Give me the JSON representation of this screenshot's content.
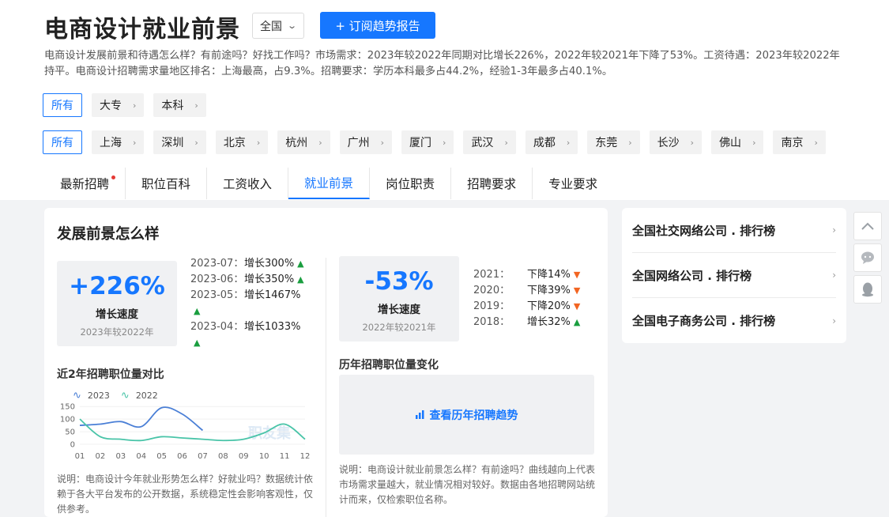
{
  "header": {
    "title": "电商设计就业前景",
    "region": "全国",
    "subscribe_label": "+ 订阅趋势报告",
    "description": "电商设计发展前景和待遇怎么样？有前途吗？好找工作吗？市场需求：2023年较2022年同期对比增长226%，2022年较2021年下降了53%。工资待遇：2023年较2022年持平。电商设计招聘需求量地区排名：上海最高，占9.3%。招聘要求：学历本科最多占44.2%，经验1-3年最多占40.1%。"
  },
  "filters": {
    "education": [
      "所有",
      "大专",
      "本科"
    ],
    "cities": [
      "所有",
      "上海",
      "深圳",
      "北京",
      "杭州",
      "广州",
      "厦门",
      "武汉",
      "成都",
      "东莞",
      "长沙",
      "佛山",
      "南京"
    ]
  },
  "tabs": [
    "最新招聘",
    "职位百科",
    "工资收入",
    "就业前景",
    "岗位职责",
    "招聘要求",
    "专业要求"
  ],
  "active_tab": 3,
  "main": {
    "title": "发展前景怎么样",
    "stat_left": {
      "value": "+226%",
      "label": "增长速度",
      "sub": "2023年较2022年"
    },
    "hist_left": [
      {
        "year": "2023-07：",
        "text": "增长300%"
      },
      {
        "year": "2023-06：",
        "text": "增长350%"
      },
      {
        "year": "2023-05：",
        "text": "增长1467%"
      },
      {
        "year": "2023-04：",
        "text": "增长1033%"
      }
    ],
    "stat_right": {
      "value": "-53%",
      "label": "增长速度",
      "sub": "2022年较2021年"
    },
    "hist_right": [
      {
        "year": "2021：",
        "text": "下降14%"
      },
      {
        "year": "2020：",
        "text": "下降39%"
      },
      {
        "year": "2019：",
        "text": "下降20%"
      },
      {
        "year": "2018：",
        "text": "增长32%"
      }
    ],
    "compare_title": "近2年招聘职位量对比",
    "trend_title": "历年招聘职位量变化",
    "trend_link": "查看历年招聘趋势",
    "watermark": "职友集",
    "note_left": "说明：电商设计今年就业形势怎么样？好就业吗？数据统计依赖于各大平台发布的公开数据，系统稳定性会影响客观性，仅供参考。",
    "note_right": "说明：电商设计就业前景怎么样？有前途吗？曲线越向上代表市场需求量越大，就业情况相对较好。数据由各地招聘网站统计而来，仅检索职位名称。"
  },
  "chart_data": {
    "type": "line",
    "x": [
      "01",
      "02",
      "03",
      "04",
      "05",
      "06",
      "07",
      "08",
      "09",
      "10",
      "11",
      "12"
    ],
    "series": [
      {
        "name": "2023",
        "color": "#4a7fd6",
        "values": [
          75,
          80,
          90,
          70,
          145,
          120,
          55,
          null,
          null,
          null,
          null,
          null
        ]
      },
      {
        "name": "2022",
        "color": "#49c4a8",
        "values": [
          100,
          30,
          20,
          15,
          30,
          25,
          20,
          15,
          20,
          45,
          80,
          20
        ]
      }
    ],
    "yticks": [
      0,
      50,
      100,
      150
    ],
    "ylim": [
      0,
      160
    ]
  },
  "side": {
    "rankings": [
      "全国社交网络公司 . 排行榜",
      "全国网络公司 . 排行榜",
      "全国电子商务公司 . 排行榜"
    ]
  },
  "icons": {
    "float": [
      "chevron-up-icon",
      "chat-bubble-icon",
      "qq-penguin-icon"
    ]
  }
}
